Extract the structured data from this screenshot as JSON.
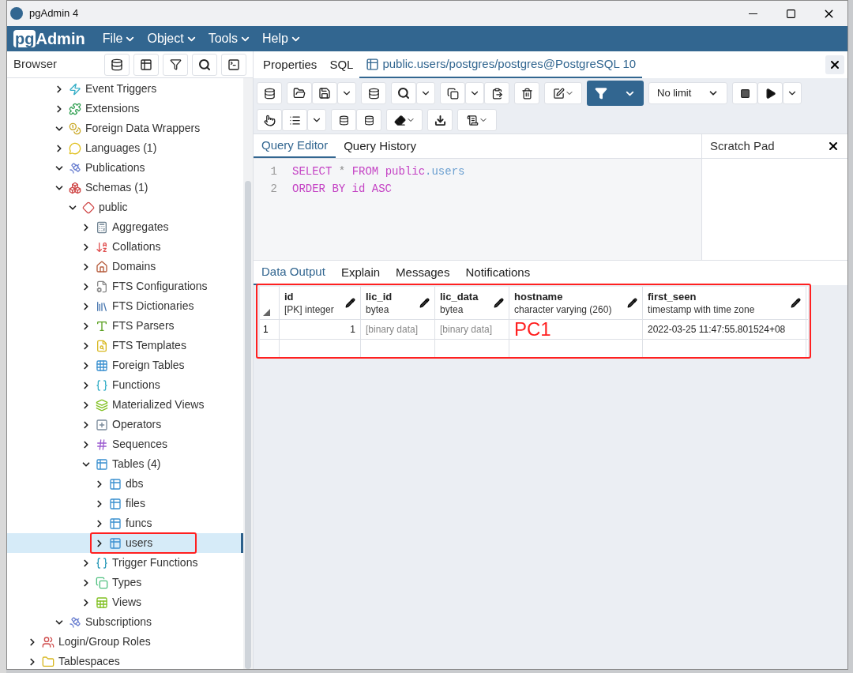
{
  "window": {
    "title": "pgAdmin 4"
  },
  "menubar": {
    "logo": {
      "prefix": "pg",
      "name": "Admin"
    },
    "menus": [
      "File",
      "Object",
      "Tools",
      "Help"
    ]
  },
  "browser": {
    "title": "Browser",
    "database_children": [
      {
        "label": "Event Triggers",
        "kind": "event-trigger",
        "expanded": false,
        "selected": false,
        "highlighted": false
      },
      {
        "label": "Extensions",
        "kind": "extension",
        "expanded": false,
        "selected": false,
        "highlighted": false
      },
      {
        "label": "Foreign Data Wrappers",
        "kind": "coins",
        "expanded": true,
        "selected": false,
        "highlighted": false
      },
      {
        "label": "Languages (1)",
        "kind": "language",
        "expanded": false,
        "selected": false,
        "highlighted": false
      },
      {
        "label": "Publications",
        "kind": "dish",
        "expanded": true,
        "selected": false,
        "highlighted": false
      },
      {
        "label": "Schemas (1)",
        "kind": "schemas",
        "expanded": true,
        "selected": false,
        "highlighted": false,
        "children": [
          {
            "label": "public",
            "kind": "schema",
            "expanded": true,
            "selected": false,
            "highlighted": false,
            "children": [
              {
                "label": "Aggregates",
                "kind": "aggregate",
                "expanded": false,
                "selected": false,
                "highlighted": false
              },
              {
                "label": "Collations",
                "kind": "collation",
                "expanded": false,
                "selected": false,
                "highlighted": false
              },
              {
                "label": "Domains",
                "kind": "domain",
                "expanded": false,
                "selected": false,
                "highlighted": false
              },
              {
                "label": "FTS Configurations",
                "kind": "fts-config",
                "expanded": false,
                "selected": false,
                "highlighted": false
              },
              {
                "label": "FTS Dictionaries",
                "kind": "fts-dict",
                "expanded": false,
                "selected": false,
                "highlighted": false
              },
              {
                "label": "FTS Parsers",
                "kind": "fts-parser",
                "expanded": false,
                "selected": false,
                "highlighted": false
              },
              {
                "label": "FTS Templates",
                "kind": "fts-template",
                "expanded": false,
                "selected": false,
                "highlighted": false
              },
              {
                "label": "Foreign Tables",
                "kind": "foreign-table",
                "expanded": false,
                "selected": false,
                "highlighted": false
              },
              {
                "label": "Functions",
                "kind": "function",
                "expanded": false,
                "selected": false,
                "highlighted": false
              },
              {
                "label": "Materialized Views",
                "kind": "mview",
                "expanded": false,
                "selected": false,
                "highlighted": false
              },
              {
                "label": "Operators",
                "kind": "operator",
                "expanded": false,
                "selected": false,
                "highlighted": false
              },
              {
                "label": "Sequences",
                "kind": "sequence",
                "expanded": false,
                "selected": false,
                "highlighted": false
              },
              {
                "label": "Tables (4)",
                "kind": "tables",
                "expanded": true,
                "selected": false,
                "highlighted": false,
                "children": [
                  {
                    "label": "dbs",
                    "kind": "table",
                    "expanded": false,
                    "selected": false,
                    "highlighted": false
                  },
                  {
                    "label": "files",
                    "kind": "table",
                    "expanded": false,
                    "selected": false,
                    "highlighted": false
                  },
                  {
                    "label": "funcs",
                    "kind": "table",
                    "expanded": false,
                    "selected": false,
                    "highlighted": false
                  },
                  {
                    "label": "users",
                    "kind": "table",
                    "expanded": false,
                    "selected": true,
                    "highlighted": true
                  }
                ]
              },
              {
                "label": "Trigger Functions",
                "kind": "trigger-function",
                "expanded": false,
                "selected": false,
                "highlighted": false
              },
              {
                "label": "Types",
                "kind": "type",
                "expanded": false,
                "selected": false,
                "highlighted": false
              },
              {
                "label": "Views",
                "kind": "view",
                "expanded": false,
                "selected": false,
                "highlighted": false
              }
            ]
          }
        ]
      },
      {
        "label": "Subscriptions",
        "kind": "dish",
        "expanded": true,
        "selected": false,
        "highlighted": false
      }
    ],
    "server_children": [
      {
        "label": "Login/Group Roles",
        "kind": "roles",
        "expanded": false,
        "selected": false,
        "highlighted": false
      },
      {
        "label": "Tablespaces",
        "kind": "folder",
        "expanded": false,
        "selected": false,
        "highlighted": false
      }
    ]
  },
  "main_tabs": [
    {
      "label": "Properties",
      "selected": false,
      "kind": "plain"
    },
    {
      "label": "SQL",
      "selected": false,
      "kind": "plain"
    },
    {
      "label": "public.users/postgres/postgres@PostgreSQL 10",
      "selected": true,
      "kind": "table"
    }
  ],
  "toolbar": {
    "row_limit": "No limit"
  },
  "editor_tabs": [
    {
      "label": "Query Editor",
      "selected": true
    },
    {
      "label": "Query History",
      "selected": false
    }
  ],
  "scratch_pad": {
    "title": "Scratch Pad"
  },
  "editor_lines": [
    {
      "number": "1",
      "tokens": [
        {
          "text": "SELECT",
          "kind": "keyword"
        },
        {
          "text": " * ",
          "kind": "operator"
        },
        {
          "text": "FROM",
          "kind": "keyword"
        },
        {
          "text": " public",
          "kind": "keyword"
        },
        {
          "text": ".users",
          "kind": "identifier"
        }
      ]
    },
    {
      "number": "2",
      "tokens": [
        {
          "text": "ORDER BY id ASC",
          "kind": "keyword"
        }
      ]
    }
  ],
  "output_tabs": [
    {
      "label": "Data Output",
      "selected": true
    },
    {
      "label": "Explain",
      "selected": false
    },
    {
      "label": "Messages",
      "selected": false
    },
    {
      "label": "Notifications",
      "selected": false
    }
  ],
  "grid": {
    "highlighted": true,
    "columns": [
      {
        "name": "id",
        "type": "[PK] integer"
      },
      {
        "name": "lic_id",
        "type": "bytea"
      },
      {
        "name": "lic_data",
        "type": "bytea"
      },
      {
        "name": "hostname",
        "type": "character varying (260)"
      },
      {
        "name": "first_seen",
        "type": "timestamp with time zone"
      }
    ],
    "rows": [
      {
        "number": "1",
        "cells": [
          {
            "text": "1",
            "kind": "number"
          },
          {
            "text": "[binary data]",
            "kind": "binary"
          },
          {
            "text": "[binary data]",
            "kind": "binary"
          },
          {
            "text": "PC1",
            "kind": "annotation"
          },
          {
            "text": "2022-03-25 11:47:55.801524+08",
            "kind": "text"
          }
        ]
      }
    ]
  }
}
